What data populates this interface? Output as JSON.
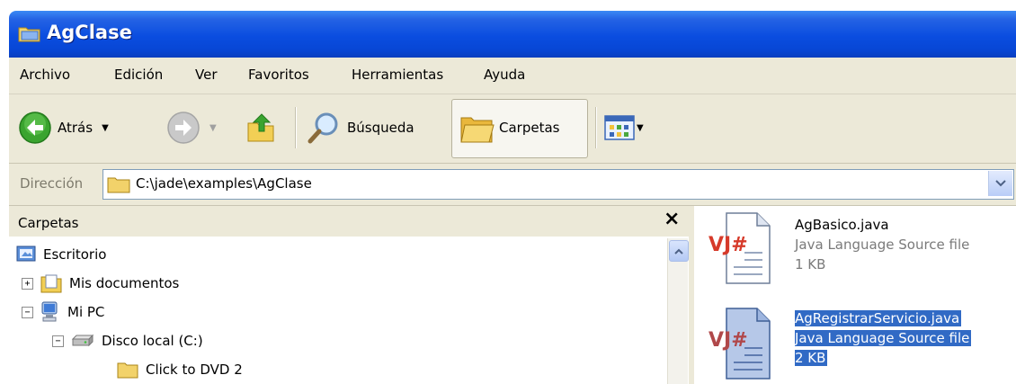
{
  "window": {
    "title": "AgClase"
  },
  "menu": [
    "Archivo",
    "Edición",
    "Ver",
    "Favoritos",
    "Herramientas",
    "Ayuda"
  ],
  "toolbar": {
    "back_label": "Atrás",
    "search_label": "Búsqueda",
    "folders_label": "Carpetas"
  },
  "address": {
    "label": "Dirección",
    "path": "C:\\jade\\examples\\AgClase"
  },
  "folders_pane": {
    "title": "Carpetas",
    "tree": [
      {
        "label": "Escritorio",
        "icon": "desktop-icon"
      },
      {
        "label": "Mis documentos",
        "icon": "my-documents-icon",
        "expander": "+"
      },
      {
        "label": "Mi PC",
        "icon": "my-computer-icon",
        "expander": "−"
      },
      {
        "label": "Disco local (C:)",
        "icon": "hard-drive-icon",
        "expander": "−"
      },
      {
        "label": "Click to DVD 2",
        "icon": "folder-icon"
      }
    ]
  },
  "files": [
    {
      "name": "AgBasico.java",
      "type": "Java Language Source file",
      "size": "1 KB",
      "icon": "vjsharp-file-icon",
      "selected": false
    },
    {
      "name": "AgRegistrarServicio.java",
      "type": "Java Language Source file",
      "size": "2 KB",
      "icon": "vjsharp-file-icon",
      "selected": true
    }
  ],
  "colors": {
    "titlebar": "#0a4de0",
    "chrome": "#ece9d8",
    "selection": "#316ac5"
  }
}
